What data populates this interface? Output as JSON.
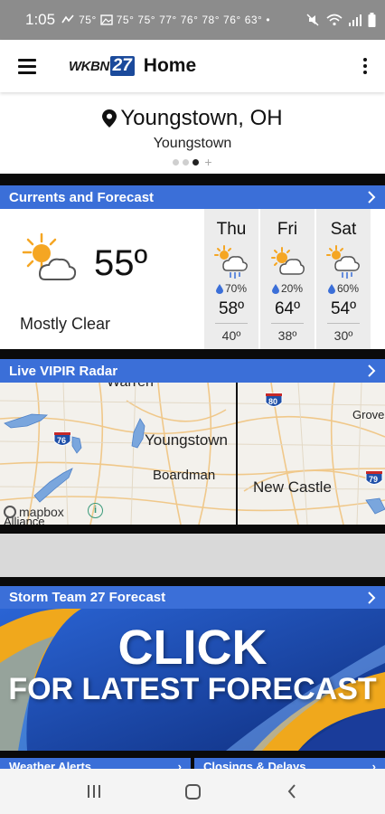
{
  "status_bar": {
    "time": "1:05",
    "notif_temps": [
      "75°",
      "75°",
      "75°",
      "77°",
      "76°",
      "78°",
      "76°",
      "63°"
    ]
  },
  "app_bar": {
    "logo_text": "WKBN",
    "logo_number": "27",
    "title": "Home"
  },
  "location": {
    "title": "Youngstown, OH",
    "subtitle": "Youngstown"
  },
  "currents": {
    "header": "Currents and Forecast",
    "temp": "55º",
    "condition": "Mostly Clear",
    "forecast": [
      {
        "day": "Thu",
        "pop": "70%",
        "hi": "58º",
        "lo": "40º",
        "icon": "partly-sunny-rain-icon"
      },
      {
        "day": "Fri",
        "pop": "20%",
        "hi": "64º",
        "lo": "38º",
        "icon": "partly-sunny-cloudy-icon"
      },
      {
        "day": "Sat",
        "pop": "60%",
        "hi": "54º",
        "lo": "30º",
        "icon": "partly-sunny-rain-icon"
      }
    ]
  },
  "radar": {
    "header": "Live VIPIR Radar",
    "labels": {
      "warren": "Warren",
      "youngstown": "Youngstown",
      "boardman": "Boardman",
      "new_castle": "New Castle",
      "grove": "Grove",
      "alliance": "Alliance"
    },
    "shields": {
      "i76": "76",
      "i80": "80",
      "i79": "79"
    },
    "attribution": "mapbox",
    "info": "i"
  },
  "storm_team": {
    "header": "Storm Team 27 Forecast",
    "banner_line1": "CLICK",
    "banner_line2": "FOR LATEST FORECAST"
  },
  "bottom_cards": {
    "left": "Weather Alerts",
    "right": "Closings & Delays"
  },
  "colors": {
    "header_blue": "#3b6fd8",
    "statusbar_gray": "#8c8c8c"
  }
}
